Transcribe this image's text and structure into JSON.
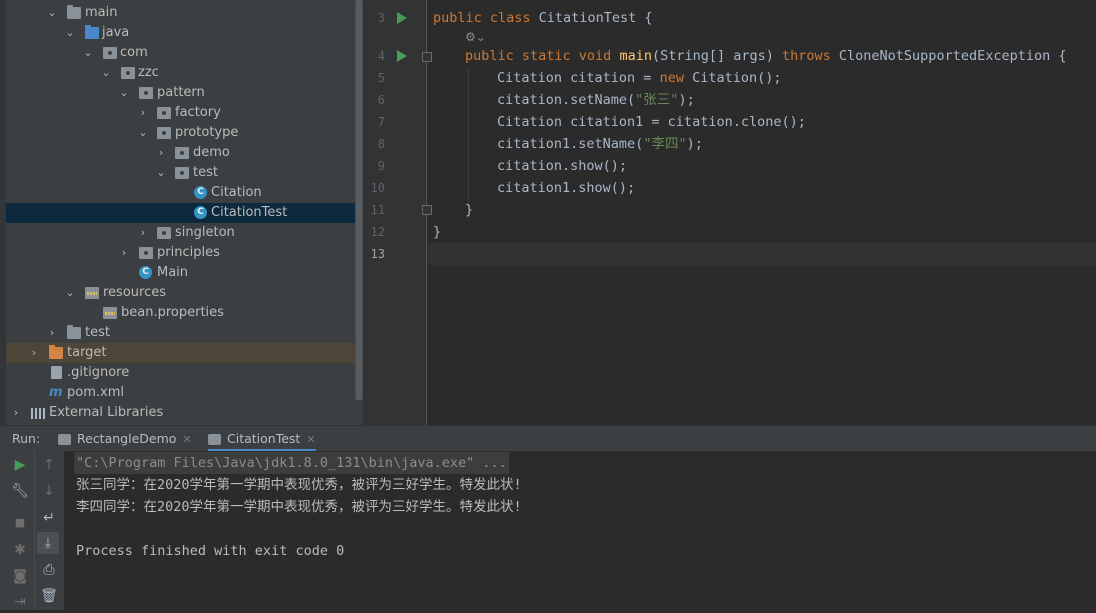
{
  "project_tree": {
    "items": [
      {
        "label": "main"
      },
      {
        "label": "java"
      },
      {
        "label": "com"
      },
      {
        "label": "zzc"
      },
      {
        "label": "pattern"
      },
      {
        "label": "factory"
      },
      {
        "label": "prototype"
      },
      {
        "label": "demo"
      },
      {
        "label": "test"
      },
      {
        "label": "Citation"
      },
      {
        "label": "CitationTest"
      },
      {
        "label": "singleton"
      },
      {
        "label": "principles"
      },
      {
        "label": "Main"
      },
      {
        "label": "resources"
      },
      {
        "label": "bean.properties"
      },
      {
        "label": "test"
      },
      {
        "label": "target"
      },
      {
        "label": ".gitignore"
      },
      {
        "label": "pom.xml"
      },
      {
        "label": "External Libraries"
      }
    ],
    "class_icon_letter": "C",
    "xml_icon_letter": "m"
  },
  "editor": {
    "line_numbers": [
      "3",
      "",
      "4",
      "5",
      "6",
      "7",
      "8",
      "9",
      "10",
      "11",
      "12",
      "13"
    ],
    "code": {
      "l3_kw": "public class ",
      "l3_rest": "CitationTest {",
      "l4_kw": "public static void ",
      "l4_fn": "main",
      "l4_args": "(String[] args) ",
      "l4_throws": "throws ",
      "l4_rest": "CloneNotSupportedException {",
      "l5_a": "Citation citation = ",
      "l5_new": "new ",
      "l5_b": "Citation();",
      "l6_a": "citation.setName(",
      "l6_str": "\"张三\"",
      "l6_b": ");",
      "l7": "Citation citation1 = citation.clone();",
      "l8_a": "citation1.setName(",
      "l8_str": "\"李四\"",
      "l8_b": ");",
      "l9": "citation.show();",
      "l10": "citation1.show();",
      "l11": "}",
      "l12": "}"
    }
  },
  "run_panel": {
    "title": "Run:",
    "tabs": [
      {
        "label": "RectangleDemo"
      },
      {
        "label": "CitationTest"
      }
    ],
    "close_glyph": "✕",
    "console": {
      "command": "\"C:\\Program Files\\Java\\jdk1.8.0_131\\bin\\java.exe\" ...",
      "out1": "张三同学：在2020学年第一学期中表现优秀，被评为三好学生。特发此状!",
      "out2": "李四同学：在2020学年第一学期中表现优秀，被评为三好学生。特发此状!",
      "exit": "Process finished with exit code 0"
    }
  },
  "colors": {
    "keyword": "#cc7832",
    "method": "#ffc66d",
    "string": "#6a8759",
    "run_green": "#499c54",
    "selection": "#0d293e"
  }
}
